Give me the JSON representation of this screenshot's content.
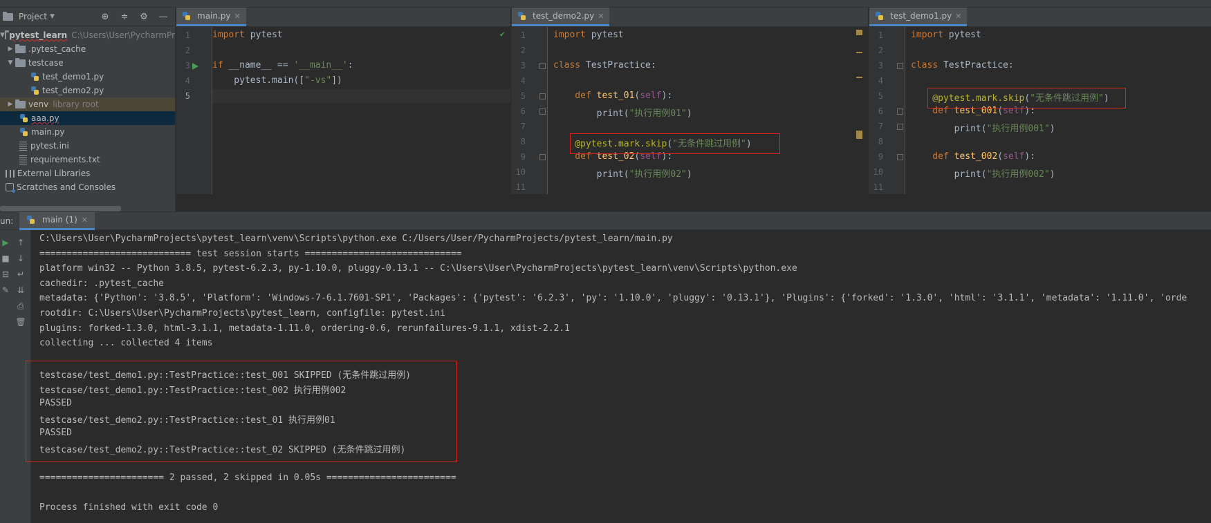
{
  "project_panel": {
    "title": "Project",
    "root": {
      "name": "pytest_learn",
      "path": "C:\\Users\\User\\PycharmPr"
    },
    "items": [
      {
        "label": "pytest_learn",
        "hint": "C:\\Users\\User\\PycharmPr"
      },
      {
        "label": ".pytest_cache"
      },
      {
        "label": "testcase"
      },
      {
        "label": "test_demo1.py"
      },
      {
        "label": "test_demo2.py"
      },
      {
        "label": "venv",
        "hint": "library root"
      },
      {
        "label": "aaa.py"
      },
      {
        "label": "main.py"
      },
      {
        "label": "pytest.ini"
      },
      {
        "label": "requirements.txt"
      },
      {
        "label": "External Libraries"
      },
      {
        "label": "Scratches and Consoles"
      }
    ]
  },
  "editors": {
    "main": {
      "tab": "main.py",
      "line_numbers": [
        "1",
        "2",
        "3",
        "4",
        "5"
      ],
      "lines": [
        [
          {
            "t": "import ",
            "c": "kw"
          },
          {
            "t": "pytest",
            "c": "cls"
          }
        ],
        [],
        [
          {
            "t": "if ",
            "c": "kw"
          },
          {
            "t": "__name__ == ",
            "c": "cls"
          },
          {
            "t": "'__main__'",
            "c": "str"
          },
          {
            "t": ":",
            "c": "cls"
          }
        ],
        [
          {
            "t": "    pytest.main([",
            "c": "cls"
          },
          {
            "t": "\"-vs\"",
            "c": "str"
          },
          {
            "t": "])",
            "c": "cls"
          }
        ],
        []
      ]
    },
    "demo2": {
      "tab": "test_demo2.py",
      "line_numbers": [
        "1",
        "2",
        "3",
        "4",
        "5",
        "6",
        "7",
        "8",
        "9",
        "10",
        "11"
      ],
      "lines": [
        [
          {
            "t": "import ",
            "c": "kw"
          },
          {
            "t": "pytest",
            "c": "cls"
          }
        ],
        [],
        [
          {
            "t": "class ",
            "c": "kw"
          },
          {
            "t": "TestPractice:",
            "c": "cls"
          }
        ],
        [],
        [
          {
            "t": "    def ",
            "c": "kw"
          },
          {
            "t": "test_01",
            "c": "fn"
          },
          {
            "t": "(",
            "c": "cls"
          },
          {
            "t": "self",
            "c": "self"
          },
          {
            "t": "):",
            "c": "cls"
          }
        ],
        [
          {
            "t": "        print(",
            "c": "cls"
          },
          {
            "t": "\"执行用例01\"",
            "c": "str"
          },
          {
            "t": ")",
            "c": "cls"
          }
        ],
        [],
        [
          {
            "t": "    @pytest.mark.skip",
            "c": "dec"
          },
          {
            "t": "(",
            "c": "cls"
          },
          {
            "t": "\"无条件跳过用例\"",
            "c": "str"
          },
          {
            "t": ")",
            "c": "cls"
          }
        ],
        [
          {
            "t": "    def ",
            "c": "kw"
          },
          {
            "t": "test_02",
            "c": "fn"
          },
          {
            "t": "(",
            "c": "cls"
          },
          {
            "t": "self",
            "c": "self"
          },
          {
            "t": "):",
            "c": "cls"
          }
        ],
        [
          {
            "t": "        print(",
            "c": "cls"
          },
          {
            "t": "\"执行用例02\"",
            "c": "str"
          },
          {
            "t": ")",
            "c": "cls"
          }
        ],
        []
      ]
    },
    "demo1": {
      "tab": "test_demo1.py",
      "line_numbers": [
        "1",
        "2",
        "3",
        "4",
        "5",
        "6",
        "7",
        "8",
        "9",
        "10",
        "11"
      ],
      "lines": [
        [
          {
            "t": "import ",
            "c": "kw"
          },
          {
            "t": "pytest",
            "c": "cls"
          }
        ],
        [],
        [
          {
            "t": "class ",
            "c": "kw"
          },
          {
            "t": "TestPractice:",
            "c": "cls"
          }
        ],
        [],
        [
          {
            "t": "    @pytest.mark.skip",
            "c": "dec"
          },
          {
            "t": "(",
            "c": "cls"
          },
          {
            "t": "\"无条件跳过用例\"",
            "c": "str"
          },
          {
            "t": ")",
            "c": "cls"
          }
        ],
        [
          {
            "t": "    def ",
            "c": "kw"
          },
          {
            "t": "test_001",
            "c": "fn"
          },
          {
            "t": "(",
            "c": "cls"
          },
          {
            "t": "self",
            "c": "self"
          },
          {
            "t": "):",
            "c": "cls"
          }
        ],
        [
          {
            "t": "        print(",
            "c": "cls"
          },
          {
            "t": "\"执行用例001\"",
            "c": "str"
          },
          {
            "t": ")",
            "c": "cls"
          }
        ],
        [],
        [
          {
            "t": "    def ",
            "c": "kw"
          },
          {
            "t": "test_002",
            "c": "fn"
          },
          {
            "t": "(",
            "c": "cls"
          },
          {
            "t": "self",
            "c": "self"
          },
          {
            "t": "):",
            "c": "cls"
          }
        ],
        [
          {
            "t": "        print(",
            "c": "cls"
          },
          {
            "t": "\"执行用例002\"",
            "c": "str"
          },
          {
            "t": ")",
            "c": "cls"
          }
        ],
        []
      ]
    }
  },
  "run_panel": {
    "label": "un:",
    "tab": "main (1)",
    "console_lines": [
      "C:\\Users\\User\\PycharmProjects\\pytest_learn\\venv\\Scripts\\python.exe C:/Users/User/PycharmProjects/pytest_learn/main.py",
      "============================ test session starts =============================",
      "platform win32 -- Python 3.8.5, pytest-6.2.3, py-1.10.0, pluggy-0.13.1 -- C:\\Users\\User\\PycharmProjects\\pytest_learn\\venv\\Scripts\\python.exe",
      "cachedir: .pytest_cache",
      "metadata: {'Python': '3.8.5', 'Platform': 'Windows-7-6.1.7601-SP1', 'Packages': {'pytest': '6.2.3', 'py': '1.10.0', 'pluggy': '0.13.1'}, 'Plugins': {'forked': '1.3.0', 'html': '3.1.1', 'metadata': '1.11.0', 'orde",
      "rootdir: C:\\Users\\User\\PycharmProjects\\pytest_learn, configfile: pytest.ini",
      "plugins: forked-1.3.0, html-3.1.1, metadata-1.11.0, ordering-0.6, rerunfailures-9.1.1, xdist-2.2.1",
      "collecting ... collected 4 items",
      "",
      "testcase/test_demo1.py::TestPractice::test_001 SKIPPED (无条件跳过用例)",
      "testcase/test_demo1.py::TestPractice::test_002 执行用例002",
      "PASSED",
      "testcase/test_demo2.py::TestPractice::test_01 执行用例01",
      "PASSED",
      "testcase/test_demo2.py::TestPractice::test_02 SKIPPED (无条件跳过用例)",
      "",
      "======================= 2 passed, 2 skipped in 0.05s ========================",
      "",
      "Process finished with exit code 0"
    ]
  },
  "colors": {
    "highlight_box": "#e0261a",
    "keyword": "#cc7832",
    "string": "#6a8759",
    "function": "#ffc66d",
    "decorator": "#bbb529"
  }
}
